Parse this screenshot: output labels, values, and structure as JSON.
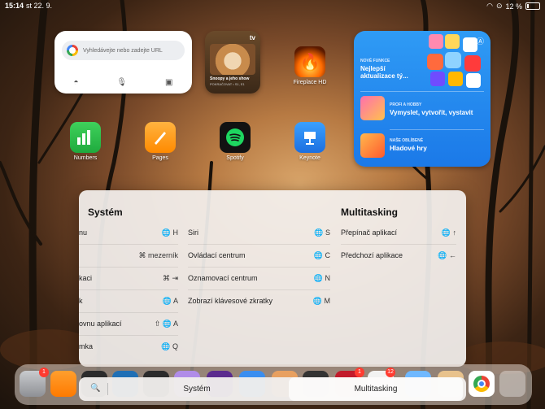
{
  "status": {
    "time": "15:14",
    "date": "st 22. 9.",
    "battery": "12 %"
  },
  "chrome_widget": {
    "placeholder": "Vyhledávejte nebo zadejte URL"
  },
  "appletv_widget": {
    "brand": "tv",
    "title": "Snoopy a jeho show",
    "subtitle": "POKRAČOVAT • S1, E1"
  },
  "apps": [
    {
      "name": "Fireplace HD"
    },
    {
      "name": "Numbers"
    },
    {
      "name": "Pages"
    },
    {
      "name": "Spotify"
    },
    {
      "name": "Keynote"
    }
  ],
  "appstore_widget": {
    "sections": [
      {
        "kicker": "NOVÉ FUNKCE",
        "headline": "Nejlepší aktualizace tý..."
      },
      {
        "kicker": "PROFI A HOBBY",
        "headline": "Vymyslet, vytvořit, vystavit"
      },
      {
        "kicker": "NAŠE OBLÍBENÉ",
        "headline": "Hladové hry"
      }
    ]
  },
  "shortcuts": {
    "systém_title": "Systém",
    "multitasking_title": "Multitasking",
    "col1": [
      {
        "label": "nu",
        "keys": "🌐 H"
      },
      {
        "label": "",
        "keys": "⌘ mezerník"
      },
      {
        "label": "kaci",
        "keys": "⌘ ⇥"
      },
      {
        "label": "k",
        "keys": "🌐 A"
      },
      {
        "label": "ovnu aplikací",
        "keys": "⇧ 🌐 A"
      },
      {
        "label": "mka",
        "keys": "🌐 Q"
      }
    ],
    "col2": [
      {
        "label": "Siri",
        "keys": "🌐 S"
      },
      {
        "label": "Ovládací centrum",
        "keys": "🌐 C"
      },
      {
        "label": "Oznamovací centrum",
        "keys": "🌐 N"
      },
      {
        "label": "Zobrazí klávesové zkratky",
        "keys": "🌐 M"
      }
    ],
    "col3": [
      {
        "label": "Přepínač aplikací",
        "keys": "🌐 ↑"
      },
      {
        "label": "Předchozí aplikace",
        "keys": "🌐 ←"
      }
    ]
  },
  "dock": {
    "badges": [
      "1",
      "1",
      "12"
    ]
  },
  "switcher": {
    "tab_system": "Systém",
    "tab_multitasking": "Multitasking",
    "active": "Multitasking"
  }
}
